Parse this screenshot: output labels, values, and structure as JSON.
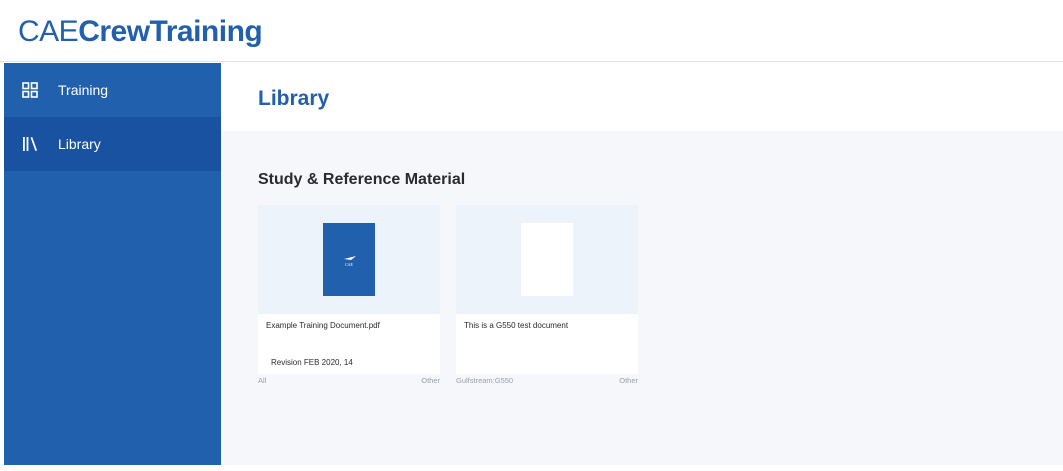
{
  "brand": {
    "part1": "CAE",
    "part2": "CrewTraining"
  },
  "sidebar": {
    "items": [
      {
        "label": "Training",
        "icon": "grid-icon"
      },
      {
        "label": "Library",
        "icon": "books-icon",
        "active": true
      }
    ]
  },
  "main": {
    "title": "Library",
    "section_title": "Study & Reference Material",
    "cards": [
      {
        "title": "Example Training Document.pdf",
        "revision": "Revision FEB 2020, 14",
        "tag_left": "All",
        "tag_right": "Other",
        "thumb": "cae-cover"
      },
      {
        "title": "This is a G550 test document",
        "revision": "",
        "tag_left": "Gulfstream:G550",
        "tag_right": "Other",
        "thumb": "blank-cover"
      }
    ]
  },
  "colors": {
    "brand_blue": "#2160ad",
    "active_nav": "#1952a0",
    "content_bg": "#f5f7fa",
    "thumb_bg": "#edf3fa"
  }
}
